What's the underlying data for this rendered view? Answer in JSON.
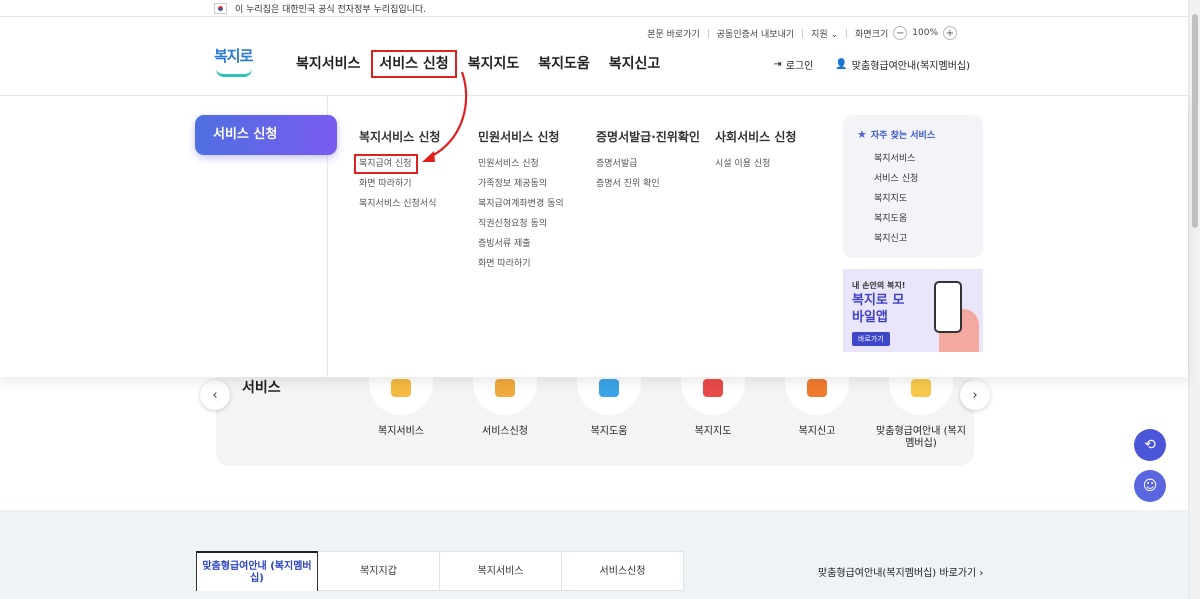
{
  "gov_banner": {
    "text": "이 누리집은 대한민국 공식 전자정부 누리집입니다."
  },
  "util": {
    "skip": "본문 바로가기",
    "cert": "공동인증서 내보내기",
    "support": "지원",
    "zoom_label": "화면크기",
    "zoom_minus": "−",
    "zoom_value": "100%",
    "zoom_plus": "+"
  },
  "logo": {
    "text": "복지로"
  },
  "gnb": [
    {
      "label": "복지서비스"
    },
    {
      "label": "서비스 신청"
    },
    {
      "label": "복지지도"
    },
    {
      "label": "복지도움"
    },
    {
      "label": "복지신고"
    }
  ],
  "header_right": {
    "login": "로그인",
    "membership": "맞춤형급여안내(복지멤버십)"
  },
  "dropdown": {
    "section_title": "서비스 신청",
    "columns": [
      {
        "title": "복지서비스 신청",
        "items": [
          "복지급여 신청",
          "화면 따라하기",
          "복지서비스 신청서식"
        ]
      },
      {
        "title": "민원서비스 신청",
        "items": [
          "민원서비스 신청",
          "가족정보 제공동의",
          "복지급여계좌변경 동의",
          "직권신청요청 동의",
          "증빙서류 제출",
          "화면 따라하기"
        ]
      },
      {
        "title": "증명서발급·진위확인",
        "items": [
          "증명서발급",
          "증명서 진위 확인"
        ]
      },
      {
        "title": "사회서비스 신청",
        "items": [
          "시설 이용 신청"
        ]
      }
    ],
    "frequent": {
      "title": "자주 찾는 서비스",
      "items": [
        "복지서비스",
        "서비스 신청",
        "복지지도",
        "복지도움",
        "복지신고"
      ]
    },
    "app_banner": {
      "small": "내 손안의 복지!",
      "big": "복지로 모바일앱",
      "button": "바로가기"
    }
  },
  "services": {
    "title": "서비스",
    "prev": "‹",
    "next": "›",
    "items": [
      {
        "label": "복지서비스",
        "color": "#f4b940"
      },
      {
        "label": "서비스신청",
        "color": "#f0a93c"
      },
      {
        "label": "복지도움",
        "color": "#3aa4e6"
      },
      {
        "label": "복지지도",
        "color": "#e84a4a"
      },
      {
        "label": "복지신고",
        "color": "#f07a2e"
      },
      {
        "label": "맞춤형급여안내 (복지멤버십)",
        "color": "#f6c84a"
      }
    ]
  },
  "fabs": {
    "recent": "⟲",
    "chatbot": "☺",
    "top": "↑"
  },
  "bottom_tabs": {
    "tabs": [
      "맞춤형급여안내 (복지멤버십)",
      "복지지갑",
      "복지서비스",
      "서비스신청"
    ],
    "link": "맞춤형급여안내(복지멤버십) 바로가기 ›"
  },
  "colors": {
    "accent": "#4b55d8",
    "highlight": "#e0201f"
  }
}
